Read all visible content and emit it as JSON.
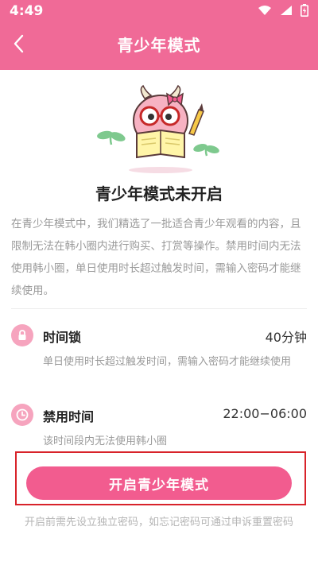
{
  "status_bar": {
    "time": "4:49"
  },
  "header": {
    "title": "青少年模式"
  },
  "main": {
    "heading": "青少年模式未开启",
    "description": "在青少年模式中，我们精选了一批适合青少年观看的内容，且限制无法在韩小圈内进行购买、打赏等操作。禁用时间内无法使用韩小圈，单日使用时长超过触发时间，需输入密码才能继续使用。"
  },
  "features": [
    {
      "label": "时间锁",
      "value": "40分钟",
      "sub": "单日使用时长超过触发时间，需输入密码才能继续使用",
      "icon": "lock-icon"
    },
    {
      "label": "禁用时间",
      "value": "22:00−06:00",
      "sub": "该时间段内无法使用韩小圈",
      "icon": "clock-icon"
    }
  ],
  "cta": {
    "label": "开启青少年模式"
  },
  "note": "开启前需先设立独立密码，如忘记密码可通过申诉重置密码",
  "colors": {
    "header": "#f06a97",
    "accent": "#f25c8f",
    "highlight": "#d8232a"
  }
}
